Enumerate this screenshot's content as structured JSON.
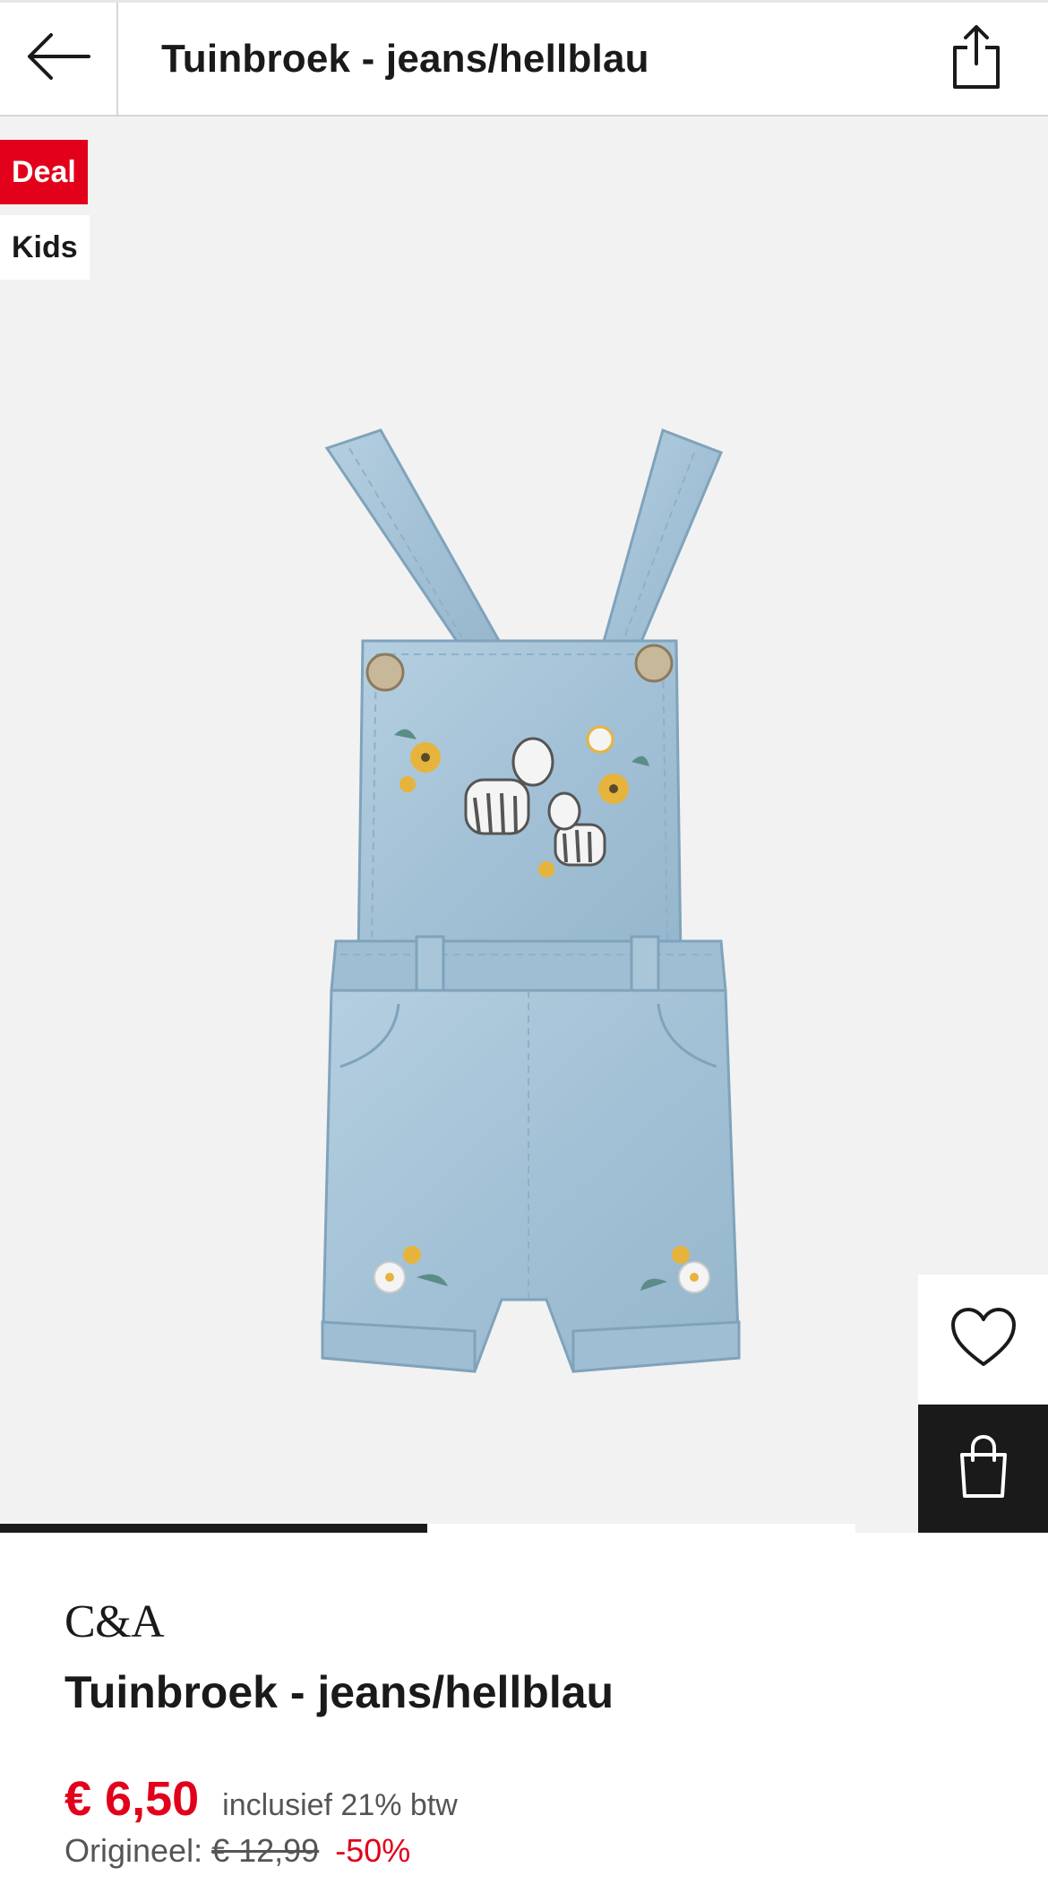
{
  "header": {
    "title": "Tuinbroek - jeans/hellblau",
    "back_icon": "arrow-left-icon",
    "share_icon": "share-icon"
  },
  "gallery": {
    "badges": [
      "Deal",
      "Kids"
    ],
    "badge_deal_color": "#e2001a",
    "image_subject": "denim-overall-shorts",
    "wishlist_icon": "heart-icon",
    "bag_icon": "shopping-bag-icon",
    "page_count": 2,
    "current_page": 1
  },
  "product": {
    "brand": "C&A",
    "title": "Tuinbroek - jeans/hellblau",
    "price": "€ 6,50",
    "vat": "inclusief 21% btw",
    "original_label": "Origineel:",
    "original_price": "€ 12,99",
    "discount": "-50%"
  },
  "colors": {
    "accent": "#e2001a",
    "denim": "#a9c6d8",
    "dark": "#1a1a1a"
  }
}
